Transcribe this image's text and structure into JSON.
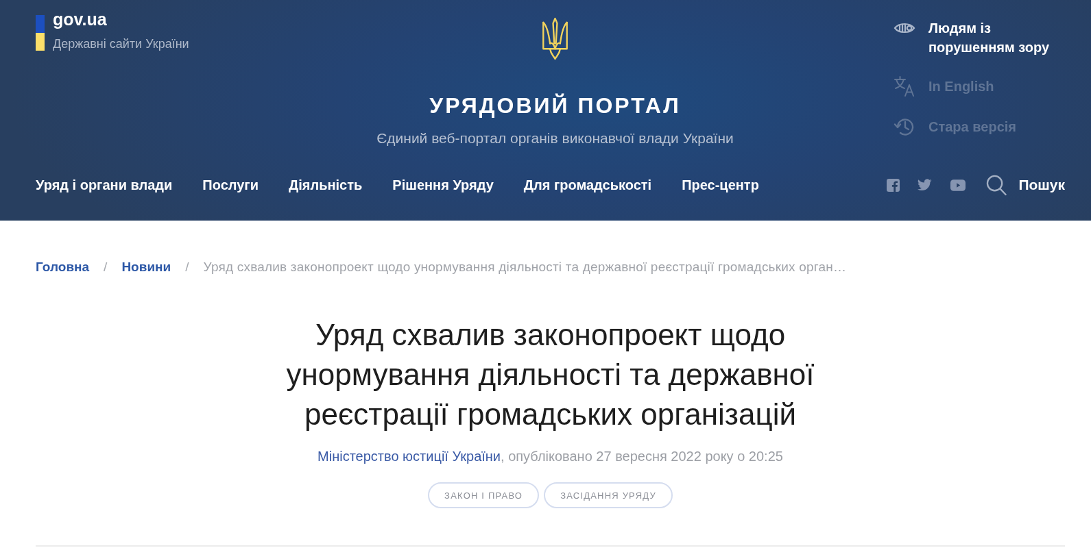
{
  "header": {
    "logo": {
      "title": "gov.ua",
      "tagline": "Державні сайти України"
    },
    "portal": {
      "title": "УРЯДОВИЙ ПОРТАЛ",
      "subtitle": "Єдиний веб-портал органів виконавчої влади України"
    },
    "utility_links": [
      {
        "kind": "accessibility",
        "label": "Людям із порушенням зору",
        "dimmed": false
      },
      {
        "kind": "language",
        "label": "In English",
        "dimmed": true
      },
      {
        "kind": "old_version",
        "label": "Стара версія",
        "dimmed": true
      }
    ],
    "nav": [
      "Уряд і органи влади",
      "Послуги",
      "Діяльність",
      "Рішення Уряду",
      "Для громадськості",
      "Прес-центр"
    ],
    "search": {
      "label": "Пошук"
    }
  },
  "breadcrumb": [
    {
      "kind": "link",
      "label": "Головна"
    },
    {
      "kind": "separator",
      "label": "/"
    },
    {
      "kind": "link",
      "label": "Новини"
    },
    {
      "kind": "separator",
      "label": "/"
    },
    {
      "kind": "current",
      "label": "Уряд схвалив законопроект щодо унормування діяльності та державної реєстрації громадських орган…"
    }
  ],
  "article": {
    "title": "Уряд схвалив законопроект щодо унормування діяльності та державної реєстрації громадських організацій",
    "source": "Міністерство юстиції України",
    "published": ", опубліковано 27 вересня 2022 року о 20:25",
    "tags": [
      "ЗАКОН І ПРАВО",
      "ЗАСІДАННЯ УРЯДУ"
    ]
  }
}
